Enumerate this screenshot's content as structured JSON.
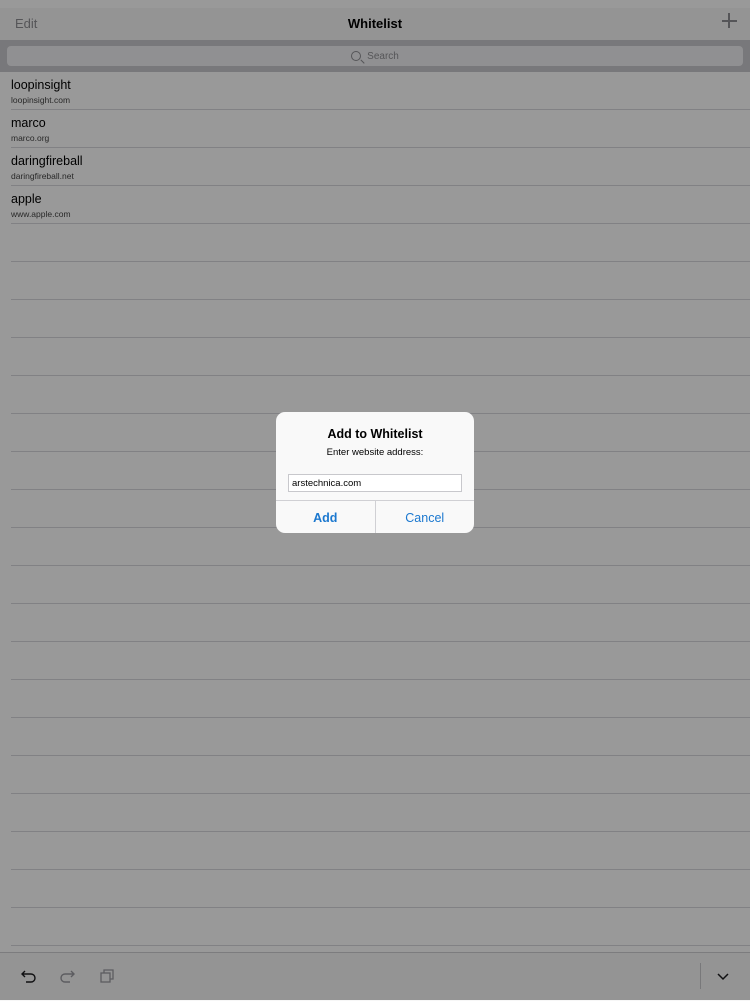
{
  "nav": {
    "edit_label": "Edit",
    "title": "Whitelist",
    "add_icon": "plus-icon"
  },
  "search": {
    "placeholder": "Search",
    "icon": "search-icon"
  },
  "list": {
    "items": [
      {
        "title": "loopinsight",
        "subtitle": "loopinsight.com"
      },
      {
        "title": "marco",
        "subtitle": "marco.org"
      },
      {
        "title": "daringfireball",
        "subtitle": "daringfireball.net"
      },
      {
        "title": "apple",
        "subtitle": "www.apple.com"
      }
    ]
  },
  "toolbar": {
    "undo_icon": "undo-icon",
    "redo_icon": "redo-icon",
    "duplicate_icon": "duplicate-icon",
    "collapse_icon": "chevron-down-icon"
  },
  "alert": {
    "title": "Add to Whitelist",
    "message": "Enter website address:",
    "input_value": "arstechnica.com",
    "add_label": "Add",
    "cancel_label": "Cancel"
  },
  "colors": {
    "accent": "#1b78cf",
    "dim_overlay": "rgba(0,0,0,0.40)"
  }
}
